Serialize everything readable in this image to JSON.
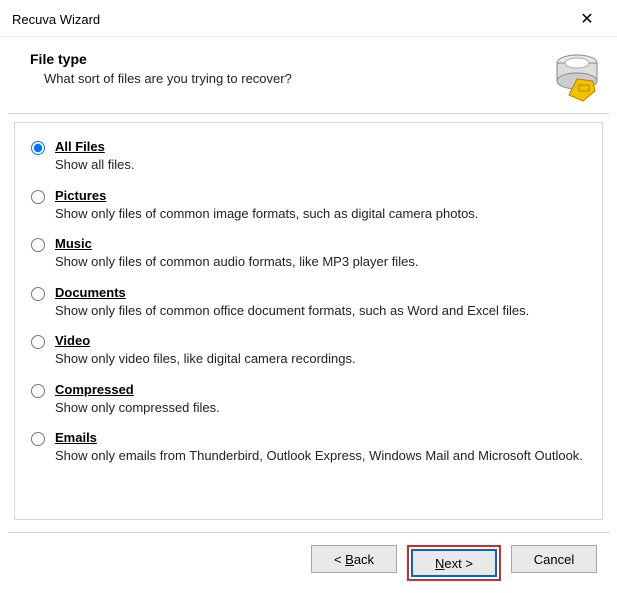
{
  "window": {
    "title": "Recuva Wizard",
    "close_glyph": "✕"
  },
  "header": {
    "title": "File type",
    "subtitle": "What sort of files are you trying to recover?"
  },
  "options": [
    {
      "id": "all",
      "checked": true,
      "label": "All Files",
      "desc": "Show all files."
    },
    {
      "id": "pictures",
      "checked": false,
      "label": "Pictures",
      "desc": "Show only files of common image formats, such as digital camera photos."
    },
    {
      "id": "music",
      "checked": false,
      "label": "Music",
      "desc": "Show only files of common audio formats, like MP3 player files."
    },
    {
      "id": "documents",
      "checked": false,
      "label": "Documents",
      "desc": "Show only files of common office document formats, such as Word and Excel files."
    },
    {
      "id": "video",
      "checked": false,
      "label": "Video",
      "desc": "Show only video files, like digital camera recordings."
    },
    {
      "id": "compressed",
      "checked": false,
      "label": "Compressed",
      "desc": "Show only compressed files."
    },
    {
      "id": "emails",
      "checked": false,
      "label": "Emails",
      "desc": "Show only emails from Thunderbird, Outlook Express, Windows Mail and Microsoft Outlook."
    }
  ],
  "buttons": {
    "back": "< Back",
    "next": "Next >",
    "cancel": "Cancel"
  }
}
